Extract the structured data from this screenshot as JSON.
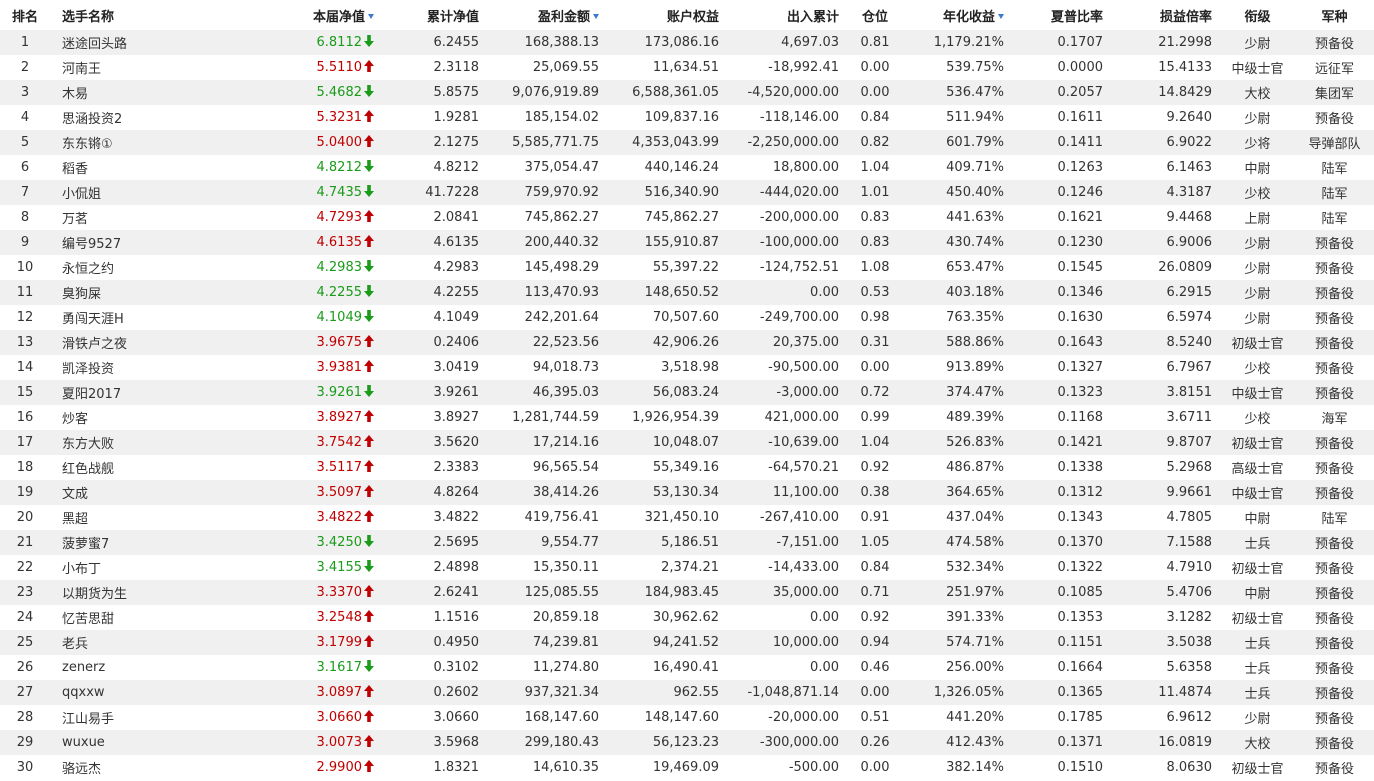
{
  "colors": {
    "up": "#c00000",
    "down": "#1a9b1a",
    "sort": "#3a7bd5",
    "row_alt": "#f0f0f0"
  },
  "headers": {
    "rank": "排名",
    "name": "选手名称",
    "nav": "本届净值",
    "cum_nav": "累计净值",
    "profit": "盈利金额",
    "equity": "账户权益",
    "inout": "出入累计",
    "position": "仓位",
    "annual": "年化收益",
    "sharpe": "夏普比率",
    "pl_ratio": "损益倍率",
    "rank_title": "衔级",
    "branch": "军种"
  },
  "rows": [
    {
      "rank": "1",
      "name": "迷途回头路",
      "nav": "6.8112",
      "dir": "down",
      "cum_nav": "6.2455",
      "profit": "168,388.13",
      "equity": "173,086.16",
      "inout": "4,697.03",
      "position": "0.81",
      "annual": "1,179.21%",
      "sharpe": "0.1707",
      "pl_ratio": "21.2998",
      "rank_title": "少尉",
      "branch": "预备役"
    },
    {
      "rank": "2",
      "name": "河南王",
      "nav": "5.5110",
      "dir": "up",
      "cum_nav": "2.3118",
      "profit": "25,069.55",
      "equity": "11,634.51",
      "inout": "-18,992.41",
      "position": "0.00",
      "annual": "539.75%",
      "sharpe": "0.0000",
      "pl_ratio": "15.4133",
      "rank_title": "中级士官",
      "branch": "远征军"
    },
    {
      "rank": "3",
      "name": "木易",
      "nav": "5.4682",
      "dir": "down",
      "cum_nav": "5.8575",
      "profit": "9,076,919.89",
      "equity": "6,588,361.05",
      "inout": "-4,520,000.00",
      "position": "0.00",
      "annual": "536.47%",
      "sharpe": "0.2057",
      "pl_ratio": "14.8429",
      "rank_title": "大校",
      "branch": "集团军"
    },
    {
      "rank": "4",
      "name": "思涵投资2",
      "nav": "5.3231",
      "dir": "up",
      "cum_nav": "1.9281",
      "profit": "185,154.02",
      "equity": "109,837.16",
      "inout": "-118,146.00",
      "position": "0.84",
      "annual": "511.94%",
      "sharpe": "0.1611",
      "pl_ratio": "9.2640",
      "rank_title": "少尉",
      "branch": "预备役"
    },
    {
      "rank": "5",
      "name": "东东锵①",
      "nav": "5.0400",
      "dir": "up",
      "cum_nav": "2.1275",
      "profit": "5,585,771.75",
      "equity": "4,353,043.99",
      "inout": "-2,250,000.00",
      "position": "0.82",
      "annual": "601.79%",
      "sharpe": "0.1411",
      "pl_ratio": "6.9022",
      "rank_title": "少将",
      "branch": "导弹部队"
    },
    {
      "rank": "6",
      "name": "稻香",
      "nav": "4.8212",
      "dir": "down",
      "cum_nav": "4.8212",
      "profit": "375,054.47",
      "equity": "440,146.24",
      "inout": "18,800.00",
      "position": "1.04",
      "annual": "409.71%",
      "sharpe": "0.1263",
      "pl_ratio": "6.1463",
      "rank_title": "中尉",
      "branch": "陆军"
    },
    {
      "rank": "7",
      "name": "小侃姐",
      "nav": "4.7435",
      "dir": "down",
      "cum_nav": "41.7228",
      "profit": "759,970.92",
      "equity": "516,340.90",
      "inout": "-444,020.00",
      "position": "1.01",
      "annual": "450.40%",
      "sharpe": "0.1246",
      "pl_ratio": "4.3187",
      "rank_title": "少校",
      "branch": "陆军"
    },
    {
      "rank": "8",
      "name": "万茗",
      "nav": "4.7293",
      "dir": "up",
      "cum_nav": "2.0841",
      "profit": "745,862.27",
      "equity": "745,862.27",
      "inout": "-200,000.00",
      "position": "0.83",
      "annual": "441.63%",
      "sharpe": "0.1621",
      "pl_ratio": "9.4468",
      "rank_title": "上尉",
      "branch": "陆军"
    },
    {
      "rank": "9",
      "name": "编号9527",
      "nav": "4.6135",
      "dir": "up",
      "cum_nav": "4.6135",
      "profit": "200,440.32",
      "equity": "155,910.87",
      "inout": "-100,000.00",
      "position": "0.83",
      "annual": "430.74%",
      "sharpe": "0.1230",
      "pl_ratio": "6.9006",
      "rank_title": "少尉",
      "branch": "预备役"
    },
    {
      "rank": "10",
      "name": "永恒之约",
      "nav": "4.2983",
      "dir": "down",
      "cum_nav": "4.2983",
      "profit": "145,498.29",
      "equity": "55,397.22",
      "inout": "-124,752.51",
      "position": "1.08",
      "annual": "653.47%",
      "sharpe": "0.1545",
      "pl_ratio": "26.0809",
      "rank_title": "少尉",
      "branch": "预备役"
    },
    {
      "rank": "11",
      "name": "臭狗屎",
      "nav": "4.2255",
      "dir": "down",
      "cum_nav": "4.2255",
      "profit": "113,470.93",
      "equity": "148,650.52",
      "inout": "0.00",
      "position": "0.53",
      "annual": "403.18%",
      "sharpe": "0.1346",
      "pl_ratio": "6.2915",
      "rank_title": "少尉",
      "branch": "预备役"
    },
    {
      "rank": "12",
      "name": "勇闯天涯H",
      "nav": "4.1049",
      "dir": "down",
      "cum_nav": "4.1049",
      "profit": "242,201.64",
      "equity": "70,507.60",
      "inout": "-249,700.00",
      "position": "0.98",
      "annual": "763.35%",
      "sharpe": "0.1630",
      "pl_ratio": "6.5974",
      "rank_title": "少尉",
      "branch": "预备役"
    },
    {
      "rank": "13",
      "name": "滑铁卢之夜",
      "nav": "3.9675",
      "dir": "up",
      "cum_nav": "0.2406",
      "profit": "22,523.56",
      "equity": "42,906.26",
      "inout": "20,375.00",
      "position": "0.31",
      "annual": "588.86%",
      "sharpe": "0.1643",
      "pl_ratio": "8.5240",
      "rank_title": "初级士官",
      "branch": "预备役"
    },
    {
      "rank": "14",
      "name": "凯泽投资",
      "nav": "3.9381",
      "dir": "up",
      "cum_nav": "3.0419",
      "profit": "94,018.73",
      "equity": "3,518.98",
      "inout": "-90,500.00",
      "position": "0.00",
      "annual": "913.89%",
      "sharpe": "0.1327",
      "pl_ratio": "6.7967",
      "rank_title": "少校",
      "branch": "预备役"
    },
    {
      "rank": "15",
      "name": "夏阳2017",
      "nav": "3.9261",
      "dir": "down",
      "cum_nav": "3.9261",
      "profit": "46,395.03",
      "equity": "56,083.24",
      "inout": "-3,000.00",
      "position": "0.72",
      "annual": "374.47%",
      "sharpe": "0.1323",
      "pl_ratio": "3.8151",
      "rank_title": "中级士官",
      "branch": "预备役"
    },
    {
      "rank": "16",
      "name": "炒客",
      "nav": "3.8927",
      "dir": "up",
      "cum_nav": "3.8927",
      "profit": "1,281,744.59",
      "equity": "1,926,954.39",
      "inout": "421,000.00",
      "position": "0.99",
      "annual": "489.39%",
      "sharpe": "0.1168",
      "pl_ratio": "3.6711",
      "rank_title": "少校",
      "branch": "海军"
    },
    {
      "rank": "17",
      "name": "东方大败",
      "nav": "3.7542",
      "dir": "up",
      "cum_nav": "3.5620",
      "profit": "17,214.16",
      "equity": "10,048.07",
      "inout": "-10,639.00",
      "position": "1.04",
      "annual": "526.83%",
      "sharpe": "0.1421",
      "pl_ratio": "9.8707",
      "rank_title": "初级士官",
      "branch": "预备役"
    },
    {
      "rank": "18",
      "name": "红色战舰",
      "nav": "3.5117",
      "dir": "up",
      "cum_nav": "2.3383",
      "profit": "96,565.54",
      "equity": "55,349.16",
      "inout": "-64,570.21",
      "position": "0.92",
      "annual": "486.87%",
      "sharpe": "0.1338",
      "pl_ratio": "5.2968",
      "rank_title": "高级士官",
      "branch": "预备役"
    },
    {
      "rank": "19",
      "name": "文成",
      "nav": "3.5097",
      "dir": "up",
      "cum_nav": "4.8264",
      "profit": "38,414.26",
      "equity": "53,130.34",
      "inout": "11,100.00",
      "position": "0.38",
      "annual": "364.65%",
      "sharpe": "0.1312",
      "pl_ratio": "9.9661",
      "rank_title": "中级士官",
      "branch": "预备役"
    },
    {
      "rank": "20",
      "name": "黑超",
      "nav": "3.4822",
      "dir": "up",
      "cum_nav": "3.4822",
      "profit": "419,756.41",
      "equity": "321,450.10",
      "inout": "-267,410.00",
      "position": "0.91",
      "annual": "437.04%",
      "sharpe": "0.1343",
      "pl_ratio": "4.7805",
      "rank_title": "中尉",
      "branch": "陆军"
    },
    {
      "rank": "21",
      "name": "菠萝蜜7",
      "nav": "3.4250",
      "dir": "down",
      "cum_nav": "2.5695",
      "profit": "9,554.77",
      "equity": "5,186.51",
      "inout": "-7,151.00",
      "position": "1.05",
      "annual": "474.58%",
      "sharpe": "0.1370",
      "pl_ratio": "7.1588",
      "rank_title": "士兵",
      "branch": "预备役"
    },
    {
      "rank": "22",
      "name": "小布丁",
      "nav": "3.4155",
      "dir": "down",
      "cum_nav": "2.4898",
      "profit": "15,350.11",
      "equity": "2,374.21",
      "inout": "-14,433.00",
      "position": "0.84",
      "annual": "532.34%",
      "sharpe": "0.1322",
      "pl_ratio": "4.7910",
      "rank_title": "初级士官",
      "branch": "预备役"
    },
    {
      "rank": "23",
      "name": "以期货为生",
      "nav": "3.3370",
      "dir": "up",
      "cum_nav": "2.6241",
      "profit": "125,085.55",
      "equity": "184,983.45",
      "inout": "35,000.00",
      "position": "0.71",
      "annual": "251.97%",
      "sharpe": "0.1085",
      "pl_ratio": "5.4706",
      "rank_title": "中尉",
      "branch": "预备役"
    },
    {
      "rank": "24",
      "name": "忆苦思甜",
      "nav": "3.2548",
      "dir": "up",
      "cum_nav": "1.1516",
      "profit": "20,859.18",
      "equity": "30,962.62",
      "inout": "0.00",
      "position": "0.92",
      "annual": "391.33%",
      "sharpe": "0.1353",
      "pl_ratio": "3.1282",
      "rank_title": "初级士官",
      "branch": "预备役"
    },
    {
      "rank": "25",
      "name": "老兵",
      "nav": "3.1799",
      "dir": "up",
      "cum_nav": "0.4950",
      "profit": "74,239.81",
      "equity": "94,241.52",
      "inout": "10,000.00",
      "position": "0.94",
      "annual": "574.71%",
      "sharpe": "0.1151",
      "pl_ratio": "3.5038",
      "rank_title": "士兵",
      "branch": "预备役"
    },
    {
      "rank": "26",
      "name": "zenerz",
      "nav": "3.1617",
      "dir": "down",
      "cum_nav": "0.3102",
      "profit": "11,274.80",
      "equity": "16,490.41",
      "inout": "0.00",
      "position": "0.46",
      "annual": "256.00%",
      "sharpe": "0.1664",
      "pl_ratio": "5.6358",
      "rank_title": "士兵",
      "branch": "预备役"
    },
    {
      "rank": "27",
      "name": "qqxxw",
      "nav": "3.0897",
      "dir": "up",
      "cum_nav": "0.2602",
      "profit": "937,321.34",
      "equity": "962.55",
      "inout": "-1,048,871.14",
      "position": "0.00",
      "annual": "1,326.05%",
      "sharpe": "0.1365",
      "pl_ratio": "11.4874",
      "rank_title": "士兵",
      "branch": "预备役"
    },
    {
      "rank": "28",
      "name": "江山易手",
      "nav": "3.0660",
      "dir": "up",
      "cum_nav": "3.0660",
      "profit": "168,147.60",
      "equity": "148,147.60",
      "inout": "-20,000.00",
      "position": "0.51",
      "annual": "441.20%",
      "sharpe": "0.1785",
      "pl_ratio": "6.9612",
      "rank_title": "少尉",
      "branch": "预备役"
    },
    {
      "rank": "29",
      "name": "wuxue",
      "nav": "3.0073",
      "dir": "up",
      "cum_nav": "3.5968",
      "profit": "299,180.43",
      "equity": "56,123.23",
      "inout": "-300,000.00",
      "position": "0.26",
      "annual": "412.43%",
      "sharpe": "0.1371",
      "pl_ratio": "16.0819",
      "rank_title": "大校",
      "branch": "预备役"
    },
    {
      "rank": "30",
      "name": "骆远杰",
      "nav": "2.9900",
      "dir": "up",
      "cum_nav": "1.8321",
      "profit": "14,610.35",
      "equity": "19,469.09",
      "inout": "-500.00",
      "position": "0.00",
      "annual": "382.14%",
      "sharpe": "0.1510",
      "pl_ratio": "8.0630",
      "rank_title": "初级士官",
      "branch": "预备役"
    }
  ]
}
